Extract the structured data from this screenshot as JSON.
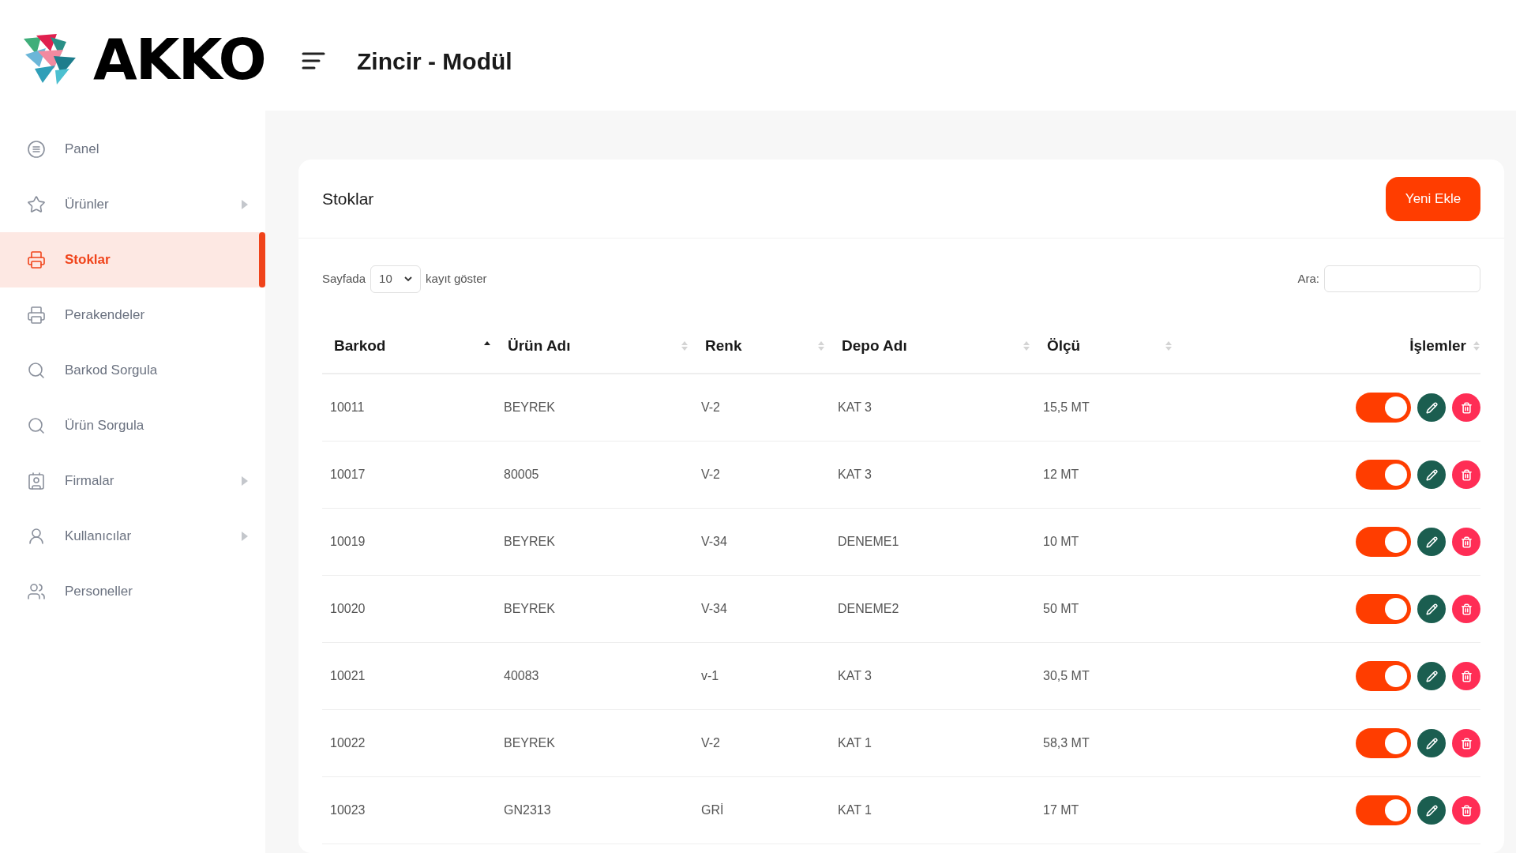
{
  "brand": {
    "name": "AKKO"
  },
  "header": {
    "title": "Zincir - Modül"
  },
  "sidebar": {
    "items": [
      {
        "label": "Panel",
        "selected": false,
        "has_submenu": false
      },
      {
        "label": "Ürünler",
        "selected": false,
        "has_submenu": true
      },
      {
        "label": "Stoklar",
        "selected": true,
        "has_submenu": false
      },
      {
        "label": "Perakendeler",
        "selected": false,
        "has_submenu": false
      },
      {
        "label": "Barkod Sorgula",
        "selected": false,
        "has_submenu": false
      },
      {
        "label": "Ürün Sorgula",
        "selected": false,
        "has_submenu": false
      },
      {
        "label": "Firmalar",
        "selected": false,
        "has_submenu": true
      },
      {
        "label": "Kullanıcılar",
        "selected": false,
        "has_submenu": true
      },
      {
        "label": "Personeller",
        "selected": false,
        "has_submenu": false
      }
    ]
  },
  "card": {
    "title": "Stoklar",
    "add_button": "Yeni Ekle",
    "length_prefix": "Sayfada",
    "length_value": "10",
    "length_suffix": "kayıt göster",
    "search_label": "Ara:"
  },
  "table": {
    "columns": [
      {
        "label": "Barkod",
        "sorted_ascending": true
      },
      {
        "label": "Ürün Adı",
        "sorted_ascending": false
      },
      {
        "label": "Renk",
        "sorted_ascending": false
      },
      {
        "label": "Depo Adı",
        "sorted_ascending": false
      },
      {
        "label": "Ölçü",
        "sorted_ascending": false
      },
      {
        "label": "İşlemler",
        "sorted_ascending": false
      }
    ],
    "rows": [
      {
        "cells": [
          "10011",
          "BEYREK",
          "V-2",
          "KAT 3",
          "15,5 MT"
        ],
        "on": true
      },
      {
        "cells": [
          "10017",
          "80005",
          "V-2",
          "KAT 3",
          "12 MT"
        ],
        "on": true
      },
      {
        "cells": [
          "10019",
          "BEYREK",
          "V-34",
          "DENEME1",
          "10 MT"
        ],
        "on": true
      },
      {
        "cells": [
          "10020",
          "BEYREK",
          "V-34",
          "DENEME2",
          "50 MT"
        ],
        "on": true
      },
      {
        "cells": [
          "10021",
          "40083",
          "v-1",
          "KAT 3",
          "30,5 MT"
        ],
        "on": true
      },
      {
        "cells": [
          "10022",
          "BEYREK",
          "V-2",
          "KAT 1",
          "58,3 MT"
        ],
        "on": true
      },
      {
        "cells": [
          "10023",
          "GN2313",
          "GRİ",
          "KAT 1",
          "17 MT"
        ],
        "on": true
      }
    ]
  }
}
